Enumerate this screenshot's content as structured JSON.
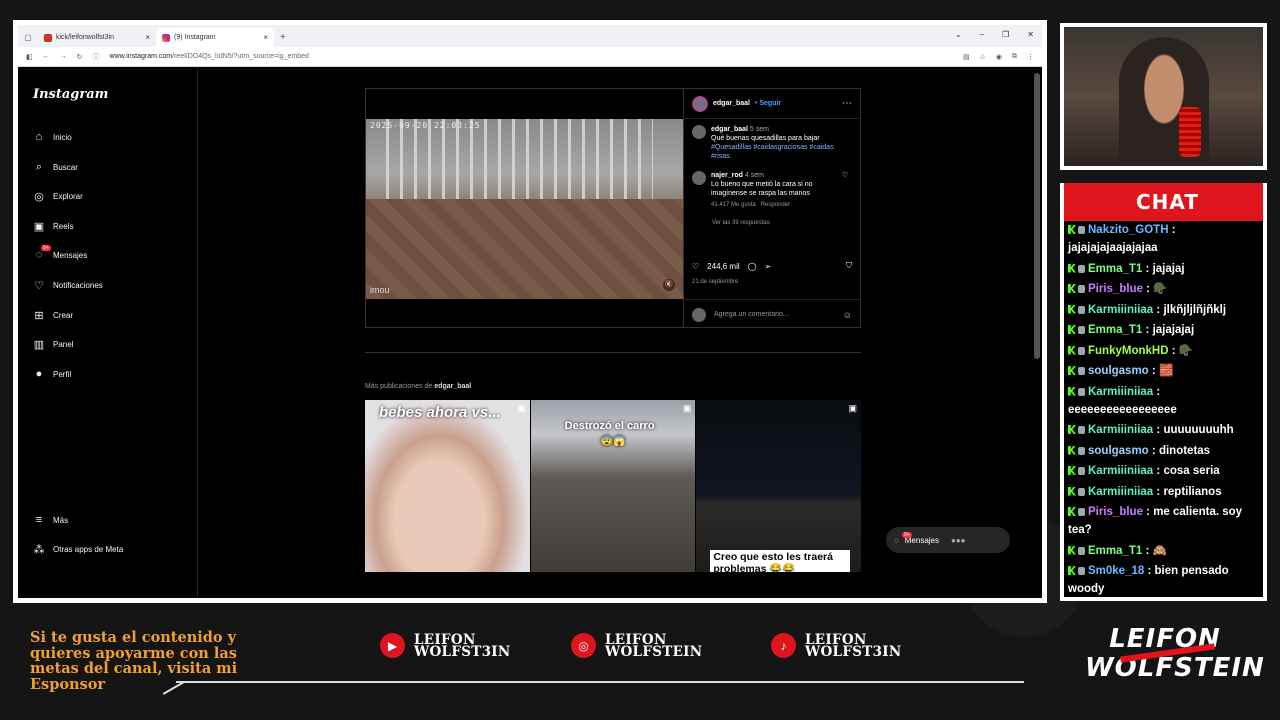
{
  "browser": {
    "tabs": [
      {
        "label": "kick/leifonwolfst3in"
      },
      {
        "label": "(9) Instagram"
      }
    ],
    "url_host": "www.instagram.com",
    "url_rest": "/reel/DO4Qs_IIdN5/?utm_source=ig_embed"
  },
  "instagram": {
    "logo": "Instagram",
    "nav": [
      {
        "label": "Inicio",
        "icon": "home-icon"
      },
      {
        "label": "Buscar",
        "icon": "search-icon"
      },
      {
        "label": "Explorar",
        "icon": "compass-icon"
      },
      {
        "label": "Reels",
        "icon": "reels-icon"
      },
      {
        "label": "Mensajes",
        "icon": "messenger-icon",
        "badge": "9+"
      },
      {
        "label": "Notificaciones",
        "icon": "heart-icon"
      },
      {
        "label": "Crear",
        "icon": "plus-icon"
      },
      {
        "label": "Panel",
        "icon": "chart-icon"
      },
      {
        "label": "Perfil",
        "icon": "avatar"
      }
    ],
    "nav_bottom": [
      {
        "label": "Más",
        "icon": "menu-icon"
      },
      {
        "label": "Otras apps de Meta",
        "icon": "apps-icon"
      }
    ],
    "post": {
      "video_timestamp": "2025-09-20 22:03:25",
      "video_watermark": "imou",
      "author": "edgar_baal",
      "follow": "• Seguir",
      "comments": [
        {
          "user": "edgar_baal",
          "time": "5 sem",
          "text": "Qué buenas quesadillas para bajar",
          "tags": "#Quesadillas #caidasgraciosas #caidas #risas"
        },
        {
          "user": "najer_rod",
          "time": "4 sem",
          "text": "Lo bueno que metió la cara si no imagínense se raspa las manos",
          "likes": "41.417 Me gusta",
          "reply": "Responder"
        }
      ],
      "view_replies": "Ver las 39 respuestas",
      "likes": "244,6 mil",
      "date": "21 de septiembre",
      "add_comment_placeholder": "Agrega un comentario..."
    },
    "more_prefix": "Más publicaciones de",
    "more_user": "edgar_baal",
    "thumbs": [
      {
        "caption": "bebes ahora vs..."
      },
      {
        "caption": "Destrozó el carro",
        "emoji": "😨😱"
      },
      {
        "caption": "Creo que esto les traerá problemas 😂😂"
      }
    ],
    "messages_pill": "Mensajes",
    "messages_badge": "9+"
  },
  "chat": {
    "title": "CHAT",
    "messages": [
      {
        "user": "Nakzito_GOTH",
        "color": "#6fb7ff",
        "text": "jajajajajaajajajaa"
      },
      {
        "user": "Emma_T1",
        "color": "#7dff7d",
        "text": "jajajaj"
      },
      {
        "user": "Piris_blue",
        "color": "#c77dff",
        "text": "🪖"
      },
      {
        "user": "Karmiiiniiaa",
        "color": "#5ff0c8",
        "text": "jlkñjljlñjñklj"
      },
      {
        "user": "Emma_T1",
        "color": "#7dff7d",
        "text": "jajajajaj"
      },
      {
        "user": "FunkyMonkHD",
        "color": "#a6ff3e",
        "text": "🪖"
      },
      {
        "user": "soulgasmo",
        "color": "#9ad0ff",
        "text": "🧱"
      },
      {
        "user": "Karmiiiniiaa",
        "color": "#5ff0c8",
        "text": "eeeeeeeeeeeeeeeee"
      },
      {
        "user": "Karmiiiniiaa",
        "color": "#5ff0c8",
        "text": "uuuuuuuuhh"
      },
      {
        "user": "soulgasmo",
        "color": "#9ad0ff",
        "text": "dinotetas"
      },
      {
        "user": "Karmiiiniiaa",
        "color": "#5ff0c8",
        "text": "cosa seria"
      },
      {
        "user": "Karmiiiniiaa",
        "color": "#5ff0c8",
        "text": "reptilianos"
      },
      {
        "user": "Piris_blue",
        "color": "#c77dff",
        "text": "me calienta. soy tea?"
      },
      {
        "user": "Emma_T1",
        "color": "#7dff7d",
        "text": "🙈"
      },
      {
        "user": "Sm0ke_18",
        "color": "#6fb7ff",
        "text": "bien pensado woody"
      }
    ]
  },
  "overlay": {
    "sponsor_text": "Si te gusta el contenido y quieres apoyarme con las metas del canal, visita mi Esponsor",
    "socials": [
      {
        "platform": "youtube",
        "icon": "youtube-icon",
        "name1": "LEIFON",
        "name2": "WOLFST3IN"
      },
      {
        "platform": "instagram",
        "icon": "instagram-icon",
        "name1": "LEIFON",
        "name2": "WOLFSTEIN"
      },
      {
        "platform": "tiktok",
        "icon": "tiktok-icon",
        "name1": "LEIFON",
        "name2": "WOLFST3IN"
      }
    ],
    "brand_line1": "LEIFON",
    "brand_line2": "WOLFSTEIN",
    "accent": "#e0141c"
  }
}
